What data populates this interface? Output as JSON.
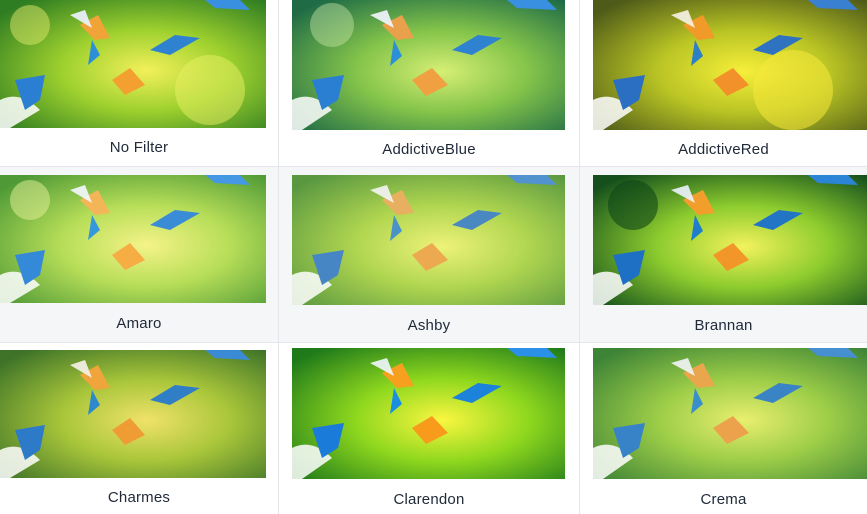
{
  "filters": [
    {
      "label": "No Filter",
      "selected": false
    },
    {
      "label": "AddictiveBlue",
      "selected": false
    },
    {
      "label": "AddictiveRed",
      "selected": false
    },
    {
      "label": "Amaro",
      "selected": true
    },
    {
      "label": "Ashby",
      "selected": true
    },
    {
      "label": "Brannan",
      "selected": true
    },
    {
      "label": "Charmes",
      "selected": false
    },
    {
      "label": "Clarendon",
      "selected": false
    },
    {
      "label": "Crema",
      "selected": false
    }
  ],
  "colors": {
    "border": "#e3e6ea",
    "selected_bg": "#f5f6f8",
    "text": "#1f2937"
  },
  "image_subject": "kingfisher-birds-photo"
}
